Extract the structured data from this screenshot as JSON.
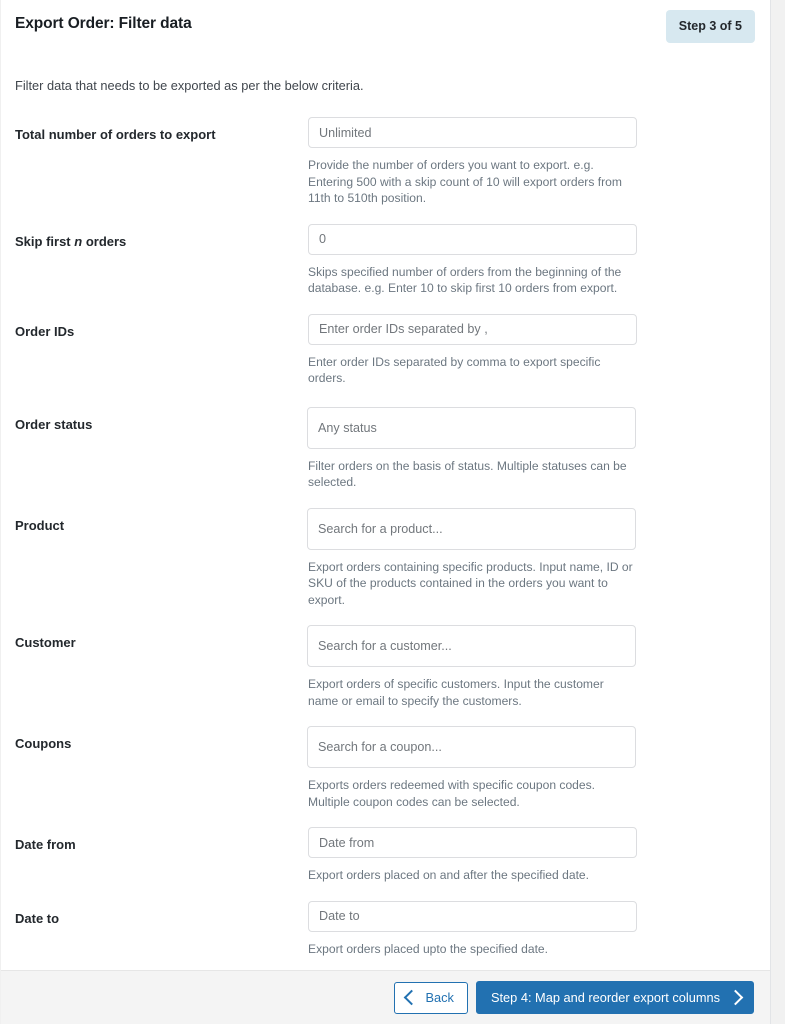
{
  "header": {
    "title": "Export Order: Filter data",
    "step_badge": "Step 3 of 5"
  },
  "intro": "Filter data that needs to be exported as per the below criteria.",
  "colors": {
    "primary": "#2271b1",
    "badge_bg": "#d7e8f0",
    "footer_bg": "#f4f4f4",
    "border": "#dcdde0",
    "help_text": "#6c7781"
  },
  "fields": [
    {
      "label": "Total number of orders to export",
      "label_pre": "Total number of orders to export",
      "control": "input",
      "value": "",
      "placeholder": "Unlimited",
      "help": "Provide the number of orders you want to export. e.g. Entering 500 with a skip count of 10 will export orders from 11th to 510th position."
    },
    {
      "label": "Skip first n orders",
      "label_pre": "Skip first ",
      "label_em": "n",
      "label_post": " orders",
      "control": "input",
      "value": "0",
      "placeholder": "0",
      "help": "Skips specified number of orders from the beginning of the database. e.g. Enter 10 to skip first 10 orders from export."
    },
    {
      "label": "Order IDs",
      "control": "input",
      "value": "",
      "placeholder": "Enter order IDs separated by ,",
      "help": "Enter order IDs separated by comma to export specific orders."
    },
    {
      "label": "Order status",
      "control": "select2",
      "placeholder": "Any status",
      "help": "Filter orders on the basis of status. Multiple statuses can be selected."
    },
    {
      "label": "Product",
      "control": "select2",
      "placeholder": "Search for a product...",
      "help": "Export orders containing specific products. Input name, ID or SKU of the products contained in the orders you want to export."
    },
    {
      "label": "Customer",
      "control": "select2",
      "placeholder": "Search for a customer...",
      "help": "Export orders of specific customers. Input the customer name or email to specify the customers."
    },
    {
      "label": "Coupons",
      "control": "select2",
      "placeholder": "Search for a coupon...",
      "help": "Exports orders redeemed with specific coupon codes. Multiple coupon codes can be selected."
    },
    {
      "label": "Date from",
      "control": "input",
      "value": "",
      "placeholder": "Date from",
      "help": "Export orders placed on and after the specified date."
    },
    {
      "label": "Date to",
      "control": "input",
      "value": "",
      "placeholder": "Date to",
      "help": "Export orders placed upto the specified date."
    }
  ],
  "footer": {
    "back_label": "Back",
    "next_label": "Step 4: Map and reorder export columns",
    "back_icon": "chevron-left-icon",
    "next_icon": "chevron-right-icon"
  }
}
